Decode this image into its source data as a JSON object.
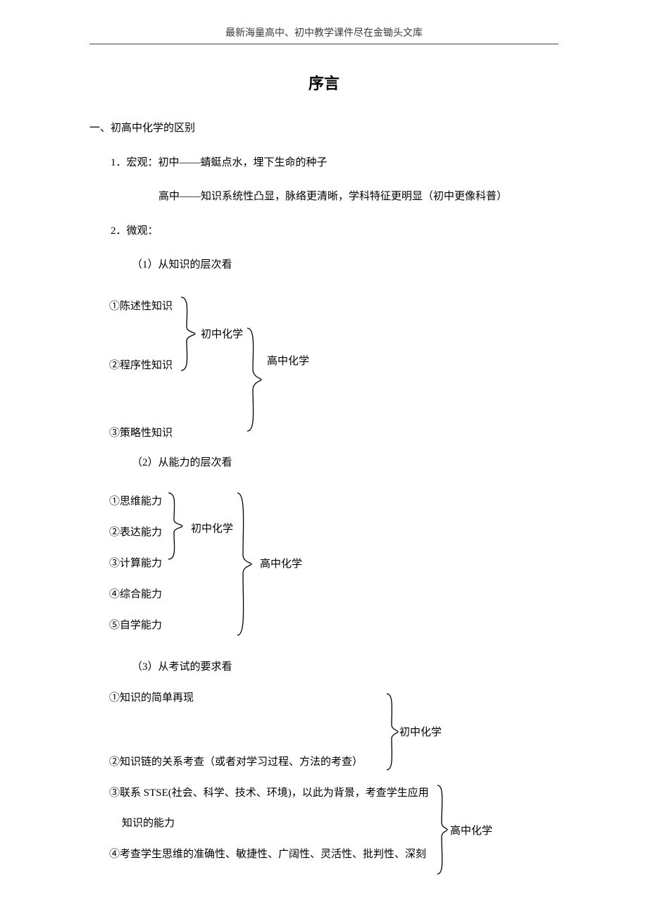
{
  "header": {
    "text": "最新海量高中、初中教学课件尽在金锄头文库"
  },
  "title": "序言",
  "section1": {
    "heading": "一、初高中化学的区别",
    "p1_label": "1．宏观：",
    "p1_junior": "初中——蜻蜓点水，埋下生命的种子",
    "p1_senior": "高中——知识系统性凸显，脉络更清晰，学科特征更明显（初中更像科普）",
    "p2_label": "2．微观：",
    "sub1": "（1）从知识的层次看",
    "k_items": {
      "k1": "①陈述性知识",
      "k2": "②程序性知识",
      "k3": "③策略性知识"
    },
    "k_labels": {
      "junior": "初中化学",
      "senior": "高中化学"
    },
    "sub2": "（2）从能力的层次看",
    "a_items": {
      "a1": "①思维能力",
      "a2": "②表达能力",
      "a3": "③计算能力",
      "a4": "④综合能力",
      "a5": "⑤自学能力"
    },
    "a_labels": {
      "junior": "初中化学",
      "senior": "高中化学"
    },
    "sub3": "（3）从考试的要求看",
    "e_items": {
      "e1": "①知识的简单再现",
      "e2": "②知识链的关系考查（或者对学习过程、方法的考查）",
      "e3a": "③联系 STSE(社会、科学、技术、环境)，以此为背景，考查学生应用",
      "e3b": "知识的能力",
      "e4": "④考查学生思维的准确性、敏捷性、广阔性、灵活性、批判性、深刻"
    },
    "e_labels": {
      "junior": "初中化学",
      "senior": "高中化学"
    }
  }
}
